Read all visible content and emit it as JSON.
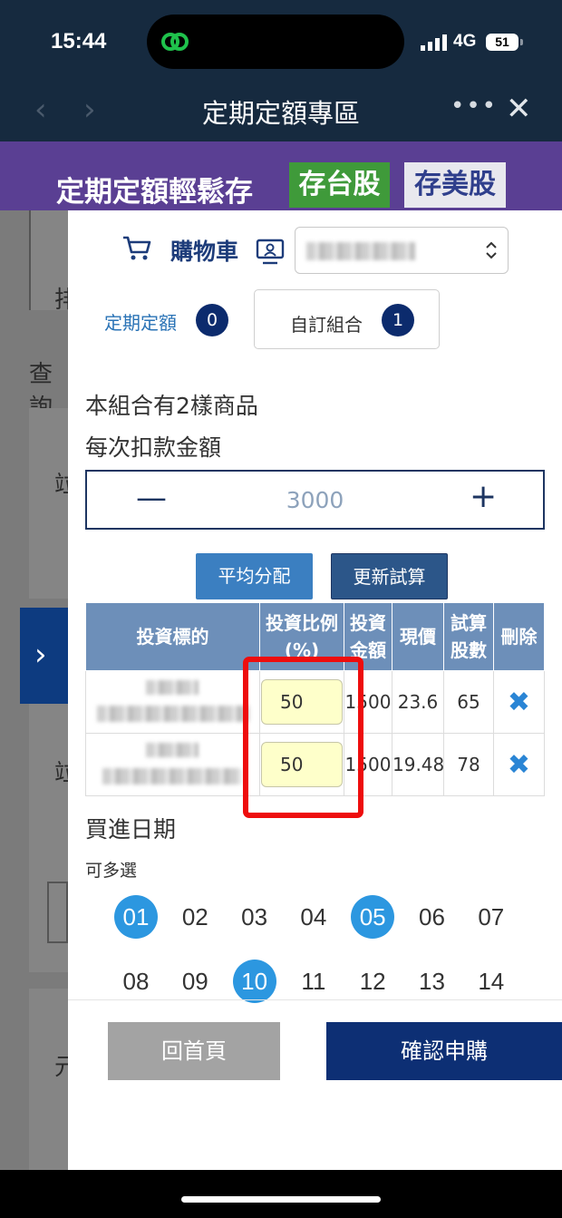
{
  "status_bar": {
    "time": "15:44",
    "network": "4G",
    "battery": "51"
  },
  "nav": {
    "title": "定期定額專區",
    "more": "•••",
    "close": "✕",
    "back": "‹",
    "forward": "›"
  },
  "banner": {
    "title": "定期定額輕鬆存",
    "tab_tw": "存台股",
    "tab_us": "存美股"
  },
  "background_page": {
    "label_1": "排",
    "label_2": "查詢",
    "label_3": "竝",
    "label_4": "竝",
    "label_5": "元",
    "expand": "›"
  },
  "cart": {
    "title": "購物車",
    "tabs": [
      {
        "label": "定期定額",
        "count": "0"
      },
      {
        "label": "自訂組合",
        "count": "1"
      }
    ],
    "item_count_text": "本組合有2樣商品",
    "deduct_label": "每次扣款金額",
    "amount": "3000",
    "minus": "—",
    "plus": "+",
    "btn_even": "平均分配",
    "btn_recalc": "更新試算",
    "table": {
      "headers": [
        "投資標的",
        "投資比例(%)",
        "投資金額",
        "現價",
        "試算股數",
        "刪除"
      ],
      "rows": [
        {
          "ratio": "50",
          "amount": "1500",
          "price": "23.6",
          "shares": "65",
          "delete": "✖"
        },
        {
          "ratio": "50",
          "amount": "1500",
          "price": "19.48",
          "shares": "78",
          "delete": "✖"
        }
      ]
    },
    "date_title": "買進日期",
    "multi_select": "可多選",
    "days": [
      "01",
      "02",
      "03",
      "04",
      "05",
      "06",
      "07",
      "08",
      "09",
      "10",
      "11",
      "12",
      "13",
      "14"
    ],
    "selected_days": [
      "01",
      "05",
      "10"
    ],
    "btn_home": "回首頁",
    "btn_confirm": "確認申購"
  },
  "colors": {
    "banner": "#5a3f93",
    "tw_tab": "#3f9a3a",
    "confirm": "#0d2f74",
    "highlight": "#ee0d0d",
    "selected_day": "#2c97e0"
  }
}
